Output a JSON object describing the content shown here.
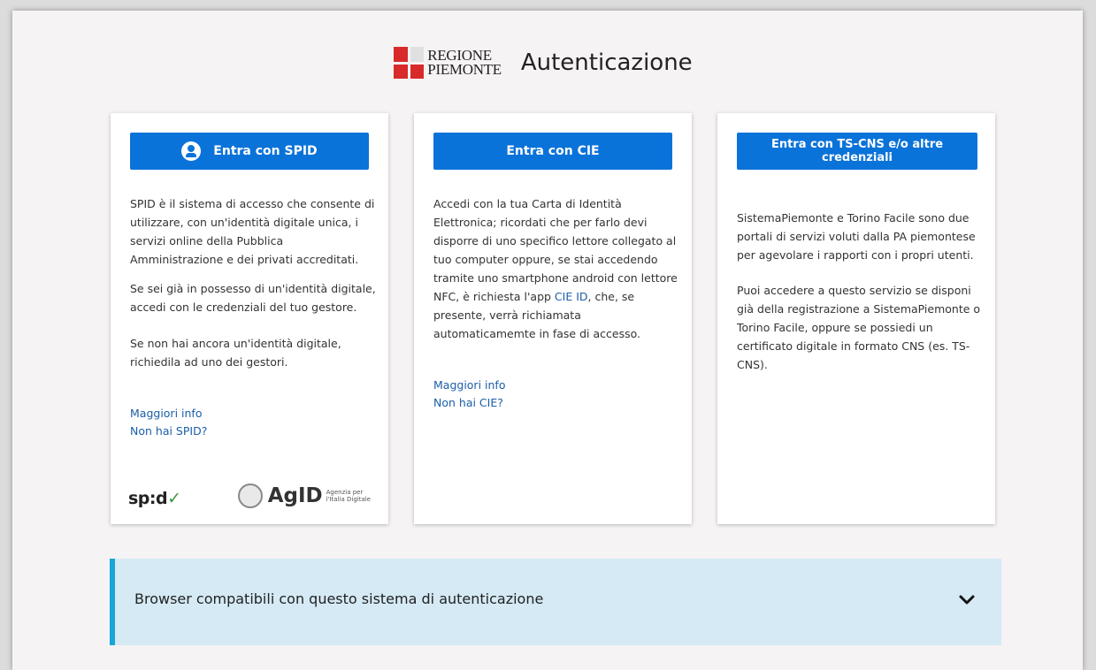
{
  "header": {
    "logo_line1": "REGIONE",
    "logo_line2": "PIEMONTE",
    "title": "Autenticazione"
  },
  "spid": {
    "button_label": "Entra con SPID",
    "para1": "SPID è il sistema di accesso che consente di utilizzare, con un'identità digitale unica, i servizi online della Pubblica Amministrazione e dei privati accreditati.",
    "para2": "Se sei già in possesso di un'identità digitale, accedi con le credenziali del tuo gestore.",
    "para3": "Se non hai ancora un'identità digitale, richiedila ad uno dei gestori.",
    "link_more": "Maggiori info",
    "link_no": "Non hai SPID?",
    "logo_spid": "sp:d",
    "logo_agid": "AgID",
    "logo_agid_sub1": "Agenzia per",
    "logo_agid_sub2": "l'Italia Digitale"
  },
  "cie": {
    "button_label": "Entra con CIE",
    "para1_before": "Accedi con la tua Carta di Identità Elettronica; ricordati che per farlo devi disporre di uno specifico lettore collegato al tuo computer oppure, se stai accedendo tramite uno smartphone android con lettore NFC, è richiesta l'app ",
    "para1_link": "CIE ID",
    "para1_after": ", che, se presente, verrà richiamata automaticamemte in fase di accesso.",
    "link_more": "Maggiori info",
    "link_no": "Non hai CIE?"
  },
  "tscns": {
    "button_label": "Entra con TS-CNS e/o altre credenziali",
    "para1": "SistemaPiemonte e Torino Facile sono due portali di servizi voluti dalla PA piemontese per agevolare i rapporti con i propri utenti.",
    "para2": "Puoi accedere a questo servizio se disponi già della registrazione a SistemaPiemonte o Torino Facile, oppure se possiedi un certificato digitale in formato CNS (es. TS-CNS)."
  },
  "accordion": {
    "label": "Browser compatibili con questo sistema di autenticazione",
    "icon": "chevron-down-icon"
  },
  "colors": {
    "primary_button": "#0a73d9",
    "link": "#1b5fa8",
    "accordion_bg": "#d5eaf5",
    "accordion_border": "#17a6d6",
    "page_bg": "#f6f3f4"
  }
}
